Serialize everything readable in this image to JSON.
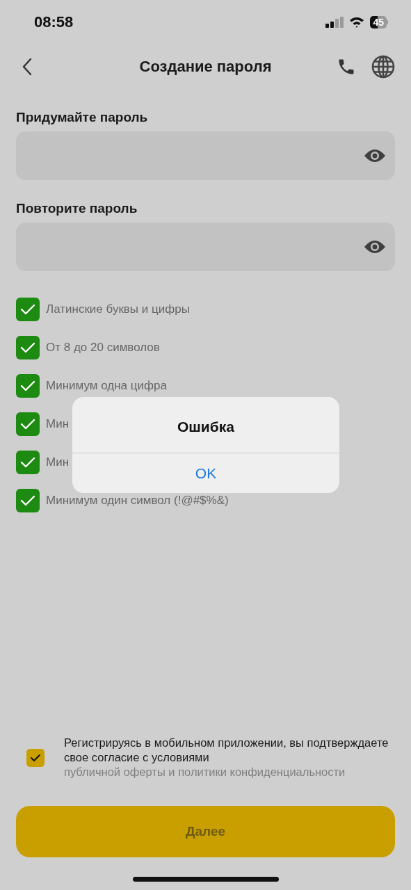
{
  "status_bar": {
    "time": "08:58",
    "battery": "45"
  },
  "nav": {
    "title": "Создание пароля"
  },
  "fields": [
    {
      "label": "Придумайте пароль"
    },
    {
      "label": "Повторите пароль"
    }
  ],
  "requirements": [
    {
      "text": "Латинские буквы и цифры",
      "checked": true
    },
    {
      "text": "От 8 до 20 символов",
      "checked": true
    },
    {
      "text": "Минимум одна цифра",
      "checked": true
    },
    {
      "text": "Мин",
      "checked": true
    },
    {
      "text": "Мин",
      "checked": true
    },
    {
      "text": "Минимум один символ (!@#$%&)",
      "checked": true
    }
  ],
  "agreement": {
    "checked": true,
    "text": "Регистрируясь в мобильном приложении, вы подтверждаете свое согласие с условиями",
    "link": "публичной оферты и политики конфиденциальности"
  },
  "next_button": {
    "label": "Далее",
    "disabled": true
  },
  "alert": {
    "title": "Ошибка",
    "button": "OK"
  }
}
